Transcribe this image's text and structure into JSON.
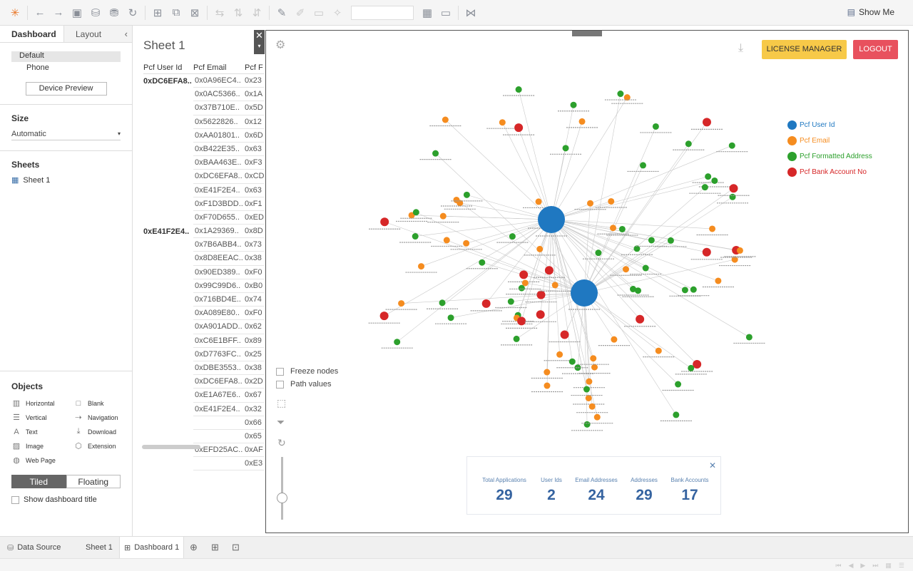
{
  "toolbar": {
    "show_me": "Show Me"
  },
  "left": {
    "tabs": {
      "dashboard": "Dashboard",
      "layout": "Layout"
    },
    "devices": [
      "Default",
      "Phone"
    ],
    "device_preview": "Device Preview",
    "size_heading": "Size",
    "size_value": "Automatic",
    "sheets_heading": "Sheets",
    "sheet_name": "Sheet 1",
    "objects_heading": "Objects",
    "objects": [
      "Horizontal",
      "Blank",
      "Vertical",
      "Navigation",
      "Text",
      "Download",
      "Image",
      "Extension",
      "Web Page"
    ],
    "tiled": "Tiled",
    "floating": "Floating",
    "show_title": "Show dashboard title"
  },
  "sheet": {
    "title": "Sheet 1",
    "headers": [
      "Pcf User Id",
      "Pcf Email",
      "Pcf F"
    ],
    "rows": [
      [
        "0xDC6EFA8..",
        "0x0A96EC4..",
        "0x23"
      ],
      [
        "",
        "0x0AC5366..",
        "0x1A"
      ],
      [
        "",
        "0x37B710E..",
        "0x5D"
      ],
      [
        "",
        "0x5622826..",
        "0x12"
      ],
      [
        "",
        "0xAA01801..",
        "0x6D"
      ],
      [
        "",
        "0xB422E35..",
        "0x63"
      ],
      [
        "",
        "0xBAA463E..",
        "0xF3"
      ],
      [
        "",
        "0xDC6EFA8..",
        "0xCD"
      ],
      [
        "",
        "0xE41F2E4..",
        "0x63"
      ],
      [
        "",
        "0xF1D3BDD..",
        "0xF1"
      ],
      [
        "",
        "0xF70D655..",
        "0xED"
      ],
      [
        "0xE41F2E4..",
        "0x1A29369..",
        "0x8D"
      ],
      [
        "",
        "0x7B6ABB4..",
        "0x73"
      ],
      [
        "",
        "0x8D8EEAC..",
        "0x38"
      ],
      [
        "",
        "0x90ED389..",
        "0xF0"
      ],
      [
        "",
        "0x99C99D6..",
        "0xB0"
      ],
      [
        "",
        "0x716BD4E..",
        "0x74"
      ],
      [
        "",
        "0xA089E80..",
        "0xF0"
      ],
      [
        "",
        "0xA901ADD..",
        "0x62"
      ],
      [
        "",
        "0xC6E1BFF..",
        "0x89"
      ],
      [
        "",
        "0xD7763FC..",
        "0x25"
      ],
      [
        "",
        "0xDBE3553..",
        "0x38"
      ],
      [
        "",
        "0xDC6EFA8..",
        "0x2D"
      ],
      [
        "",
        "0xE1A67E6..",
        "0x67"
      ],
      [
        "",
        "0xE41F2E4..",
        "0x32"
      ],
      [
        "",
        "",
        "0x66"
      ],
      [
        "",
        "",
        "0x65"
      ],
      [
        "",
        "0xEFD25AC..",
        "0xAF"
      ],
      [
        "",
        "",
        "0xE3"
      ]
    ]
  },
  "dashboard": {
    "license_button": "LICENSE MANAGER",
    "logout_button": "LOGOUT",
    "legend": [
      {
        "label": "Pcf User Id",
        "color": "#1f78c1"
      },
      {
        "label": "Pcf Email",
        "color": "#f58c1f"
      },
      {
        "label": "Pcf Formatted Address",
        "color": "#2ca02c"
      },
      {
        "label": "Pcf Bank Account No",
        "color": "#d62728"
      }
    ],
    "freeze_nodes": "Freeze nodes",
    "path_values": "Path values",
    "stats": [
      {
        "label": "Total Applications",
        "value": "29"
      },
      {
        "label": "User Ids",
        "value": "2"
      },
      {
        "label": "Email Addresses",
        "value": "24"
      },
      {
        "label": "Addresses",
        "value": "29"
      },
      {
        "label": "Bank Accounts",
        "value": "17"
      }
    ]
  },
  "bottom": {
    "data_source": "Data Source",
    "sheet_tab": "Sheet 1",
    "dashboard_tab": "Dashboard 1"
  }
}
